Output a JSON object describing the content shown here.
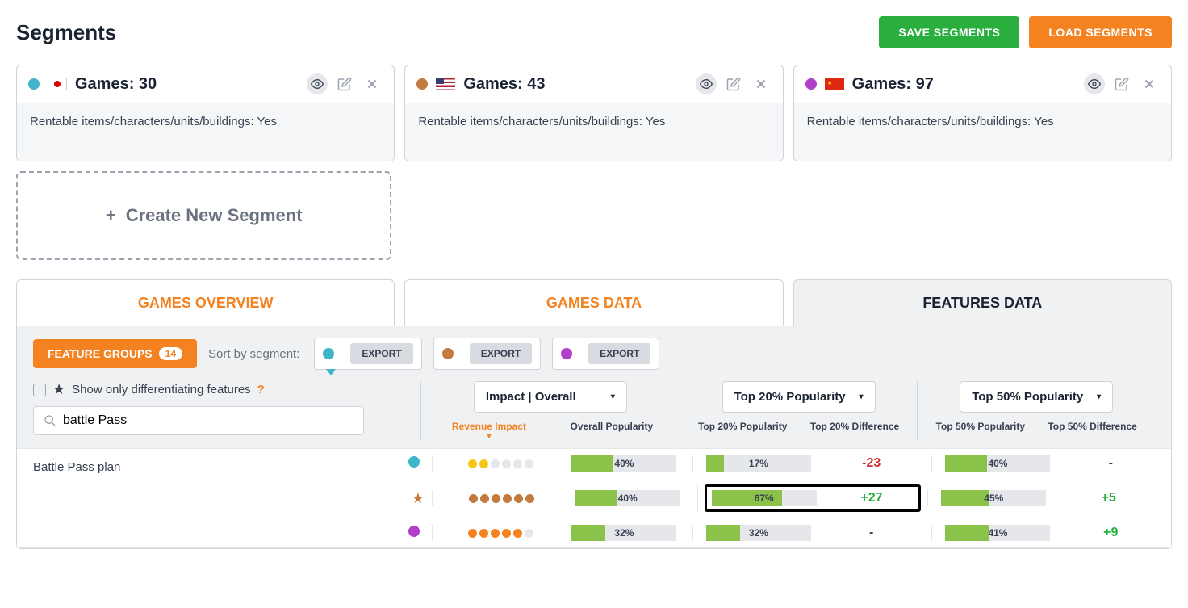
{
  "page_title": "Segments",
  "buttons": {
    "save": "SAVE SEGMENTS",
    "load": "LOAD SEGMENTS"
  },
  "segments": [
    {
      "color": "blue",
      "flag": "japan",
      "title": "Games: 30",
      "filter_label": "Rentable items/characters/units/buildings: ",
      "filter_value": "Yes"
    },
    {
      "color": "brown",
      "flag": "usa",
      "title": "Games: 43",
      "filter_label": "Rentable items/characters/units/buildings: ",
      "filter_value": "Yes"
    },
    {
      "color": "purple",
      "flag": "china",
      "title": "Games: 97",
      "filter_label": "Rentable items/characters/units/buildings: ",
      "filter_value": "Yes"
    }
  ],
  "create_new": "Create New Segment",
  "tabs": {
    "overview": "GAMES OVERVIEW",
    "data": "GAMES DATA",
    "features": "FEATURES DATA"
  },
  "feature_groups": {
    "label": "FEATURE GROUPS",
    "count": "14"
  },
  "sort_label": "Sort by segment:",
  "export_label": "EXPORT",
  "show_diff": "Show only differentiating features",
  "search_value": "battle Pass",
  "dropdowns": {
    "impact": "Impact | Overall",
    "top20": "Top 20% Popularity",
    "top50": "Top 50% Popularity"
  },
  "col_headers": {
    "revenue_impact": "Revenue Impact",
    "overall_pop": "Overall Popularity",
    "top20_pop": "Top 20% Popularity",
    "top20_diff": "Top 20% Difference",
    "top50_pop": "Top 50% Popularity",
    "top50_diff": "Top 50% Difference"
  },
  "feature_row": {
    "name": "Battle Pass plan",
    "lines": [
      {
        "marker": "dot-blue",
        "impact_filled": 2,
        "impact_color": "yellow",
        "overall": "40%",
        "overall_pct": 40,
        "t20": "17%",
        "t20_pct": 17,
        "t20_diff": "-23",
        "t20_diff_class": "diff-neg",
        "t50": "40%",
        "t50_pct": 40,
        "t50_diff": "-",
        "t50_diff_class": "diff-neutral",
        "highlight": false
      },
      {
        "marker": "star",
        "impact_filled": 6,
        "impact_color": "brown",
        "overall": "40%",
        "overall_pct": 40,
        "t20": "67%",
        "t20_pct": 67,
        "t20_diff": "+27",
        "t20_diff_class": "diff-pos",
        "t50": "45%",
        "t50_pct": 45,
        "t50_diff": "+5",
        "t50_diff_class": "diff-pos",
        "highlight": true
      },
      {
        "marker": "dot-purple",
        "impact_filled": 5,
        "impact_color": "orange",
        "overall": "32%",
        "overall_pct": 32,
        "t20": "32%",
        "t20_pct": 32,
        "t20_diff": "-",
        "t20_diff_class": "diff-neutral",
        "t50": "41%",
        "t50_pct": 41,
        "t50_diff": "+9",
        "t50_diff_class": "diff-pos",
        "highlight": false
      }
    ]
  }
}
